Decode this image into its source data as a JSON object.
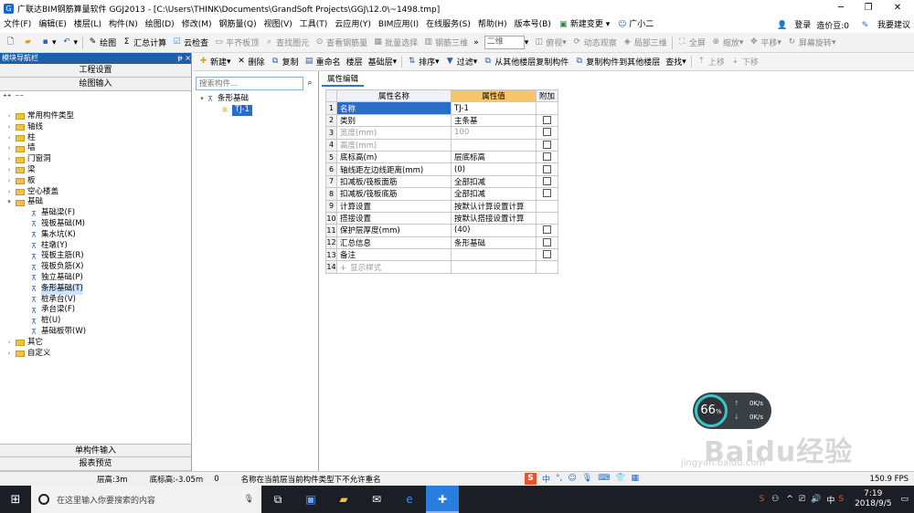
{
  "window": {
    "title": "广联达BIM钢筋算量软件 GGJ2013 - [C:\\Users\\THINK\\Documents\\GrandSoft Projects\\GGJ\\12.0\\~1498.tmp]"
  },
  "menu": {
    "items": [
      "文件(F)",
      "编辑(E)",
      "楼层(L)",
      "构件(N)",
      "绘图(D)",
      "修改(M)",
      "钢筋量(Q)",
      "视图(V)",
      "工具(T)",
      "云应用(Y)",
      "BIM应用(I)",
      "在线服务(S)",
      "帮助(H)",
      "版本号(B)",
      "新建变更",
      "广小二"
    ],
    "login": "登录",
    "beans": "造价豆:0",
    "suggest": "我要建议"
  },
  "toolbar": {
    "draw": "绘图",
    "sum": "汇总计算",
    "cloud_check": "云检查",
    "flat_board": "平齐板顶",
    "find_element": "查找图元",
    "view_rebar": "查看钢筋量",
    "batch_select": "批量选择",
    "rebar_3d": "钢筋三维",
    "view_mode": "二维",
    "top_view": "俯视",
    "dynamic": "动态观察",
    "local_3d": "局部三维",
    "fullscreen": "全屏",
    "zoom": "缩放",
    "pan": "平移",
    "rotate": "屏幕旋转"
  },
  "nav": {
    "title": "模块导航栏",
    "pin": "ᵽ ×",
    "project_settings": "工程设置",
    "drawing_input": "绘图输入",
    "single_input": "单构件输入",
    "report_preview": "报表预览",
    "tree": [
      {
        "label": "常用构件类型",
        "type": "folder"
      },
      {
        "label": "轴线",
        "type": "folder"
      },
      {
        "label": "柱",
        "type": "folder"
      },
      {
        "label": "墙",
        "type": "folder"
      },
      {
        "label": "门窗洞",
        "type": "folder"
      },
      {
        "label": "梁",
        "type": "folder"
      },
      {
        "label": "板",
        "type": "folder"
      },
      {
        "label": "空心楼盖",
        "type": "folder"
      },
      {
        "label": "基础",
        "type": "folder-open"
      },
      {
        "label": "基础梁(F)",
        "type": "item"
      },
      {
        "label": "筏板基础(M)",
        "type": "item"
      },
      {
        "label": "集水坑(K)",
        "type": "item"
      },
      {
        "label": "柱墩(Y)",
        "type": "item"
      },
      {
        "label": "筏板主筋(R)",
        "type": "item"
      },
      {
        "label": "筏板负筋(X)",
        "type": "item"
      },
      {
        "label": "独立基础(P)",
        "type": "item"
      },
      {
        "label": "条形基础(T)",
        "type": "item-selected"
      },
      {
        "label": "桩承台(V)",
        "type": "item"
      },
      {
        "label": "承台梁(F)",
        "type": "item"
      },
      {
        "label": "桩(U)",
        "type": "item"
      },
      {
        "label": "基础板带(W)",
        "type": "item"
      },
      {
        "label": "其它",
        "type": "folder"
      },
      {
        "label": "自定义",
        "type": "folder"
      }
    ]
  },
  "actions": {
    "new": "新建",
    "delete": "删除",
    "copy": "复制",
    "rename": "重命名",
    "floor_label": "楼层",
    "floor_value": "基础层",
    "sort": "排序",
    "filter": "过滤",
    "copy_from_floor": "从其他楼层复制构件",
    "copy_to_floor": "复制构件到其他楼层",
    "find": "查找",
    "move_up": "上移",
    "move_down": "下移"
  },
  "search": {
    "placeholder": "搜索构件..."
  },
  "component_tree": {
    "root": "条形基础",
    "child": "TJ-1"
  },
  "props": {
    "tab": "属性编辑",
    "header_name": "属性名称",
    "header_value": "属性值",
    "header_add": "附加",
    "rows": [
      {
        "n": "1",
        "name": "名称",
        "value": "TJ-1",
        "cb": false,
        "dim": false
      },
      {
        "n": "2",
        "name": "类别",
        "value": "主条基",
        "cb": true,
        "dim": false
      },
      {
        "n": "3",
        "name": "宽度(mm)",
        "value": "100",
        "cb": true,
        "dim": true
      },
      {
        "n": "4",
        "name": "高度(mm)",
        "value": "",
        "cb": true,
        "dim": true
      },
      {
        "n": "5",
        "name": "底标高(m)",
        "value": "层底标高",
        "cb": true,
        "dim": false
      },
      {
        "n": "6",
        "name": "轴线距左边线距离(mm)",
        "value": "(0)",
        "cb": true,
        "dim": false
      },
      {
        "n": "7",
        "name": "扣减板/筏板面筋",
        "value": "全部扣减",
        "cb": true,
        "dim": false
      },
      {
        "n": "8",
        "name": "扣减板/筏板底筋",
        "value": "全部扣减",
        "cb": true,
        "dim": false
      },
      {
        "n": "9",
        "name": "计算设置",
        "value": "按默认计算设置计算",
        "cb": false,
        "dim": false
      },
      {
        "n": "10",
        "name": "搭接设置",
        "value": "按默认搭接设置计算",
        "cb": false,
        "dim": false
      },
      {
        "n": "11",
        "name": "保护层厚度(mm)",
        "value": "(40)",
        "cb": true,
        "dim": false
      },
      {
        "n": "12",
        "name": "汇总信息",
        "value": "条形基础",
        "cb": true,
        "dim": false
      },
      {
        "n": "13",
        "name": "备注",
        "value": "",
        "cb": true,
        "dim": false
      },
      {
        "n": "14",
        "name": "显示样式",
        "value": "",
        "cb": false,
        "dim": true,
        "expand": "+"
      }
    ]
  },
  "status": {
    "floor_height": "层高:3m",
    "bottom_elev": "底标高:-3.05m",
    "count": "0",
    "message": "名称在当前层当前构件类型下不允许重名",
    "fps": "150.9 FPS"
  },
  "ime": {
    "lang": "中"
  },
  "widget": {
    "percent": "66",
    "percent_unit": "%",
    "up": "0K/s",
    "down": "0K/s"
  },
  "watermark": {
    "brand": "Baidu经验",
    "url": "jingyan.baidu.com"
  },
  "taskbar": {
    "search_placeholder": "在这里输入你要搜索的内容",
    "time": "7:19",
    "date": "2018/9/5",
    "ime": "中"
  }
}
